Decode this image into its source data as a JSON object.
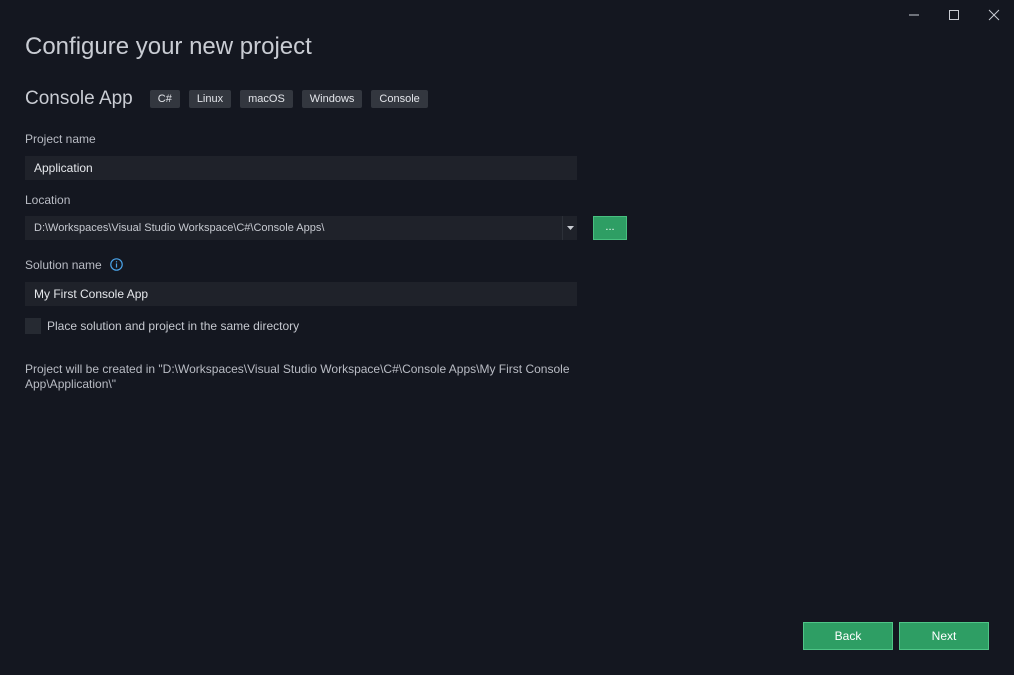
{
  "window": {
    "minimize_icon": "minimize-icon",
    "maximize_icon": "maximize-icon",
    "close_icon": "close-icon"
  },
  "page": {
    "title": "Configure your new project"
  },
  "template": {
    "name": "Console App",
    "tags": [
      "C#",
      "Linux",
      "macOS",
      "Windows",
      "Console"
    ]
  },
  "project_name": {
    "label": "Project name",
    "value": "Application"
  },
  "location": {
    "label": "Location",
    "value": "D:\\Workspaces\\Visual Studio Workspace\\C#\\Console Apps\\",
    "browse_label": "..."
  },
  "solution_name": {
    "label": "Solution name",
    "value": "My First Console App",
    "info_icon": "info-icon"
  },
  "same_directory": {
    "label": "Place solution and project in the same directory",
    "checked": false
  },
  "created_note": "Project will be created in \"D:\\Workspaces\\Visual Studio Workspace\\C#\\Console Apps\\My First Console App\\Application\\\"",
  "footer": {
    "back_label": "Back",
    "next_label": "Next"
  },
  "colors": {
    "background": "#141720",
    "accent": "#2e9e64",
    "field_bg": "#1f222a",
    "tag_bg": "#33373f"
  }
}
